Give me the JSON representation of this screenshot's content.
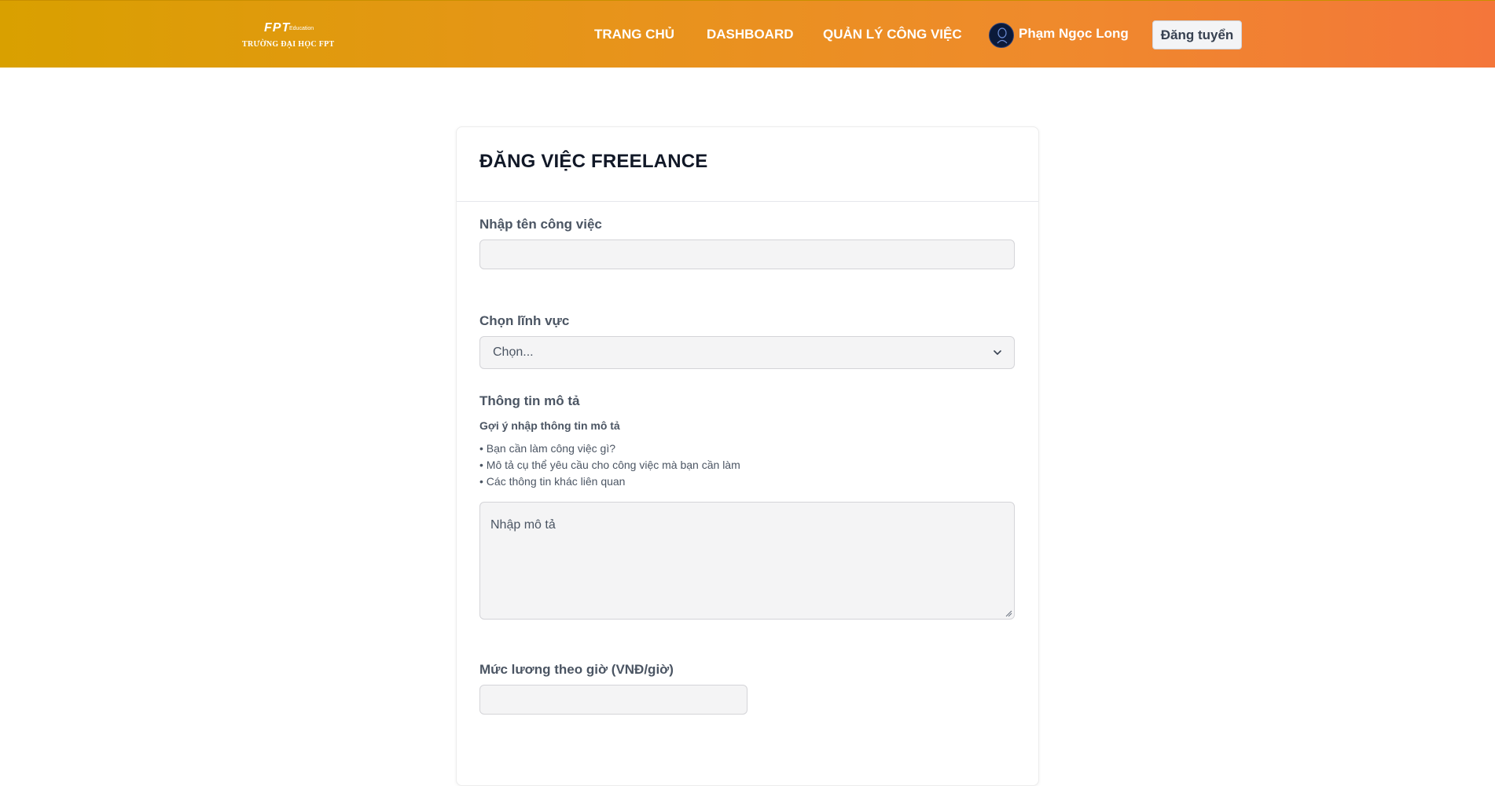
{
  "header": {
    "logo": {
      "mark": "FPT",
      "edu": "Education",
      "school": "TRƯỜNG ĐẠI HỌC FPT"
    },
    "nav": [
      "TRANG CHỦ",
      "DASHBOARD",
      "QUẢN LÝ CÔNG VIỆC"
    ],
    "user_name": "Phạm Ngọc Long",
    "post_button": "Đăng tuyển"
  },
  "form": {
    "title": "ĐĂNG VIỆC FREELANCE",
    "job_name": {
      "label": "Nhập tên công việc",
      "value": ""
    },
    "field": {
      "label": "Chọn lĩnh vực",
      "selected": "Chọn..."
    },
    "description": {
      "label": "Thông tin mô tả",
      "hint_title": "Gợi ý nhập thông tin mô tả",
      "hints": [
        "• Bạn cần làm công việc gì?",
        "• Mô tả cụ thể yêu cầu cho công việc mà bạn cần làm",
        "• Các thông tin khác liên quan"
      ],
      "placeholder": "Nhập mô tả"
    },
    "salary": {
      "label": "Mức lương theo giờ (VNĐ/giờ)",
      "value": ""
    }
  },
  "colors": {
    "header_start": "#d9a000",
    "header_end": "#f4763a"
  }
}
